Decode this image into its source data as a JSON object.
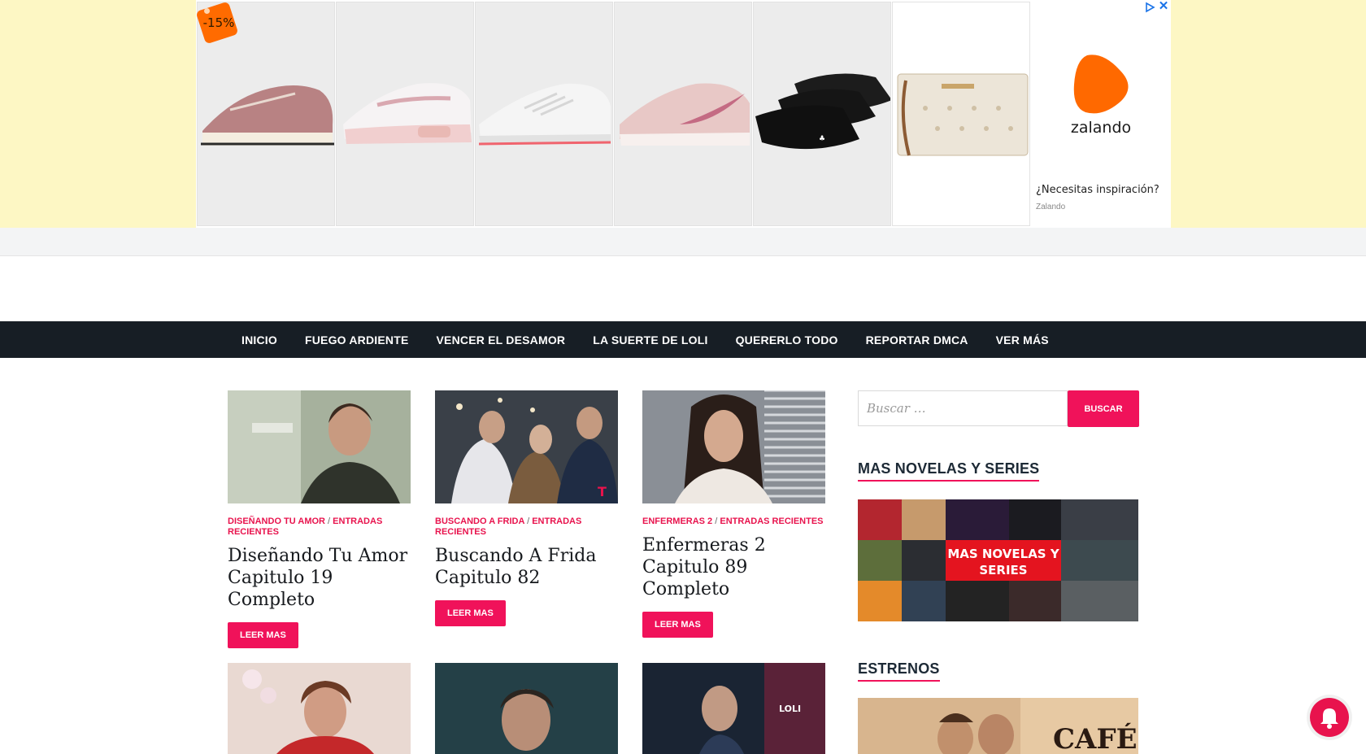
{
  "ad": {
    "discount": "-15%",
    "brand": "zalando",
    "caption": "¿Necesitas inspiración?",
    "source": "Zalando",
    "products": [
      "pink-sneaker",
      "white-pink-sneaker",
      "white-running-shoe",
      "pink-nike-shoe",
      "black-face-masks",
      "monogram-clutch"
    ],
    "colors": {
      "background": "#fdf7c4",
      "discount": "#ff6b00",
      "brand_orange": "#ff6900"
    }
  },
  "nav": {
    "items": [
      "INICIO",
      "FUEGO ARDIENTE",
      "VENCER EL DESAMOR",
      "LA SUERTE DE LOLI",
      "QUERERLO TODO",
      "REPORTAR DMCA",
      "VER MÁS"
    ]
  },
  "posts": [
    {
      "cat1": "DISEÑANDO TU AMOR",
      "cat2": "ENTRADAS RECIENTES",
      "title": "Diseñando Tu Amor Capitulo 19 Completo",
      "button": "LEER MAS"
    },
    {
      "cat1": "BUSCANDO A FRIDA",
      "cat2": "ENTRADAS RECIENTES",
      "title": "Buscando A Frida Capitulo 82",
      "button": "LEER MAS"
    },
    {
      "cat1": "ENFERMERAS 2",
      "cat2": "ENTRADAS RECIENTES",
      "title": "Enfermeras 2 Capitulo 89 Completo",
      "button": "LEER MAS"
    }
  ],
  "sidebar": {
    "search_placeholder": "Buscar …",
    "search_button": "BUSCAR",
    "widget1_title": "MAS NOVELAS Y SERIES",
    "collage_text": "MAS NOVELAS Y SERIES",
    "widget2_title": "ESTRENOS",
    "estrenos_text": "CAFÉ"
  },
  "theme": {
    "accent": "#f0125a",
    "nav_bg": "#171e25"
  }
}
